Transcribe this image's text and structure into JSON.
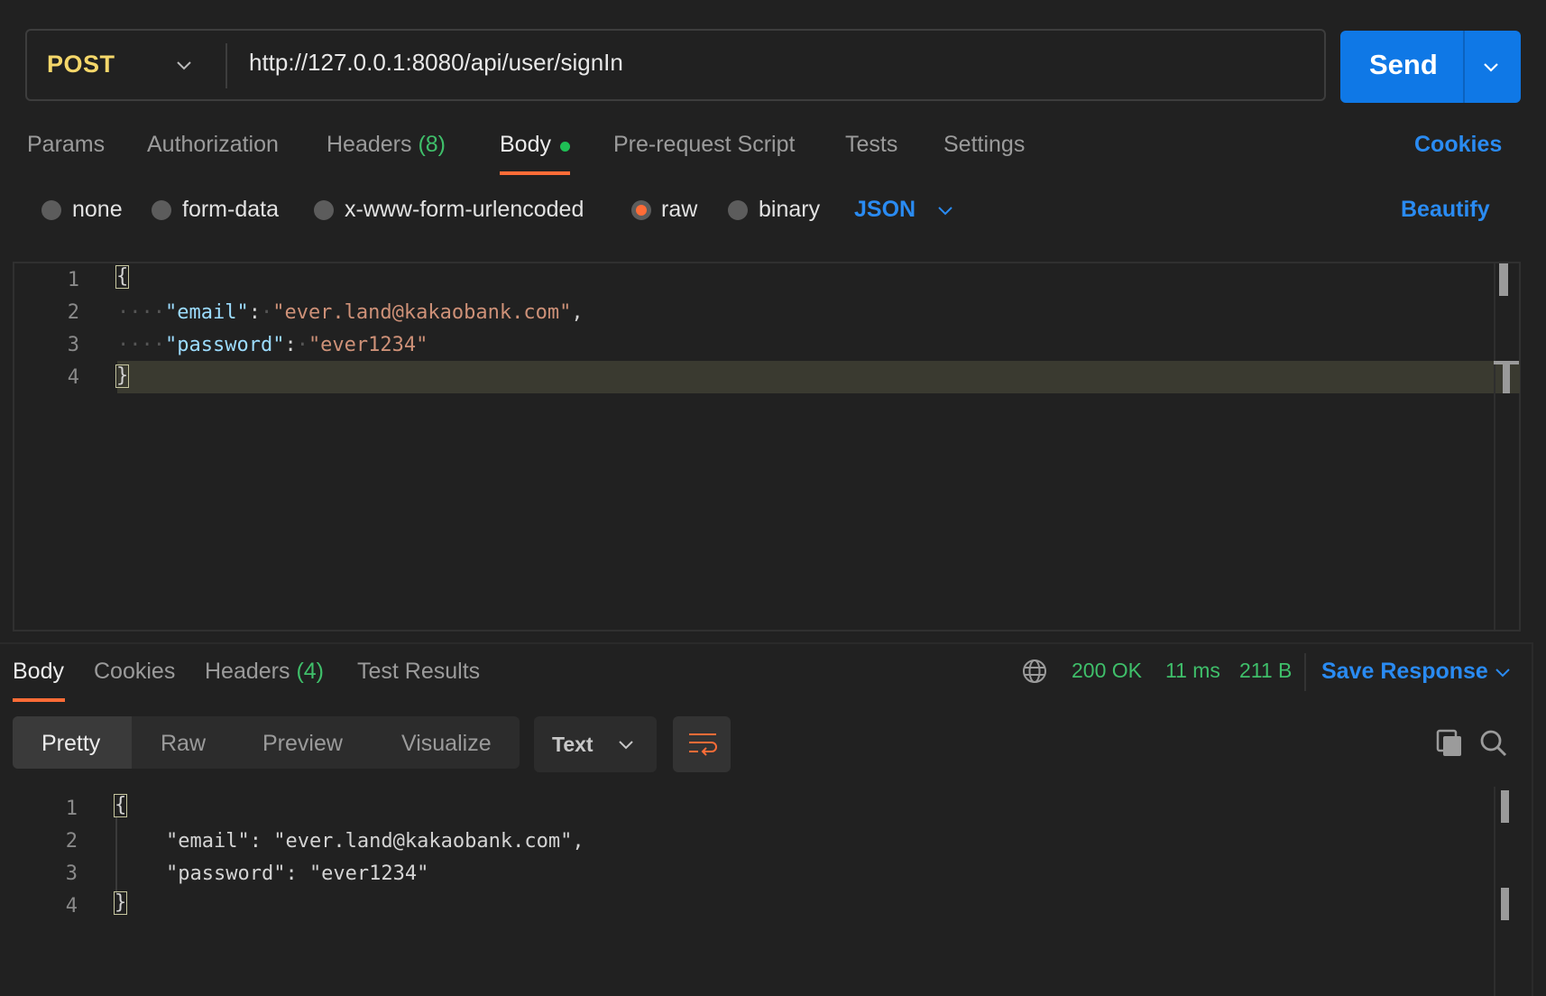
{
  "request": {
    "method": "POST",
    "url": "http://127.0.0.1:8080/api/user/signIn",
    "send_label": "Send"
  },
  "request_tabs": [
    {
      "label": "Params"
    },
    {
      "label": "Authorization"
    },
    {
      "label": "Headers",
      "count": "(8)"
    },
    {
      "label": "Body"
    },
    {
      "label": "Pre-request Script"
    },
    {
      "label": "Tests"
    },
    {
      "label": "Settings"
    }
  ],
  "cookies_link": "Cookies",
  "body_types": {
    "none": "none",
    "form_data": "form-data",
    "urlencoded": "x-www-form-urlencoded",
    "raw": "raw",
    "binary": "binary",
    "selected": "raw",
    "format": "JSON",
    "beautify": "Beautify"
  },
  "request_body": {
    "line_numbers": [
      "1",
      "2",
      "3",
      "4"
    ],
    "open_brace": "{",
    "close_brace": "}",
    "email_key": "\"email\"",
    "email_value": "\"ever.land@kakaobank.com\"",
    "password_key": "\"password\"",
    "password_value": "\"ever1234\""
  },
  "response_tabs": [
    {
      "label": "Body"
    },
    {
      "label": "Cookies"
    },
    {
      "label": "Headers",
      "count": "(4)"
    },
    {
      "label": "Test Results"
    }
  ],
  "response_meta": {
    "status": "200 OK",
    "time": "11 ms",
    "size": "211 B",
    "save_response": "Save Response"
  },
  "view_modes": {
    "pretty": "Pretty",
    "raw": "Raw",
    "preview": "Preview",
    "visualize": "Visualize",
    "format": "Text"
  },
  "response_body": {
    "line_numbers": [
      "1",
      "2",
      "3",
      "4"
    ],
    "open_brace": "{",
    "close_brace": "}",
    "line2": "\"email\": \"ever.land@kakaobank.com\",",
    "line3": "\"password\": \"ever1234\""
  },
  "colors": {
    "accent": "#ff6c37",
    "link": "#2a8bf2",
    "send": "#0f78e6",
    "method": "#f5d76a",
    "success": "#3fbf6a"
  }
}
